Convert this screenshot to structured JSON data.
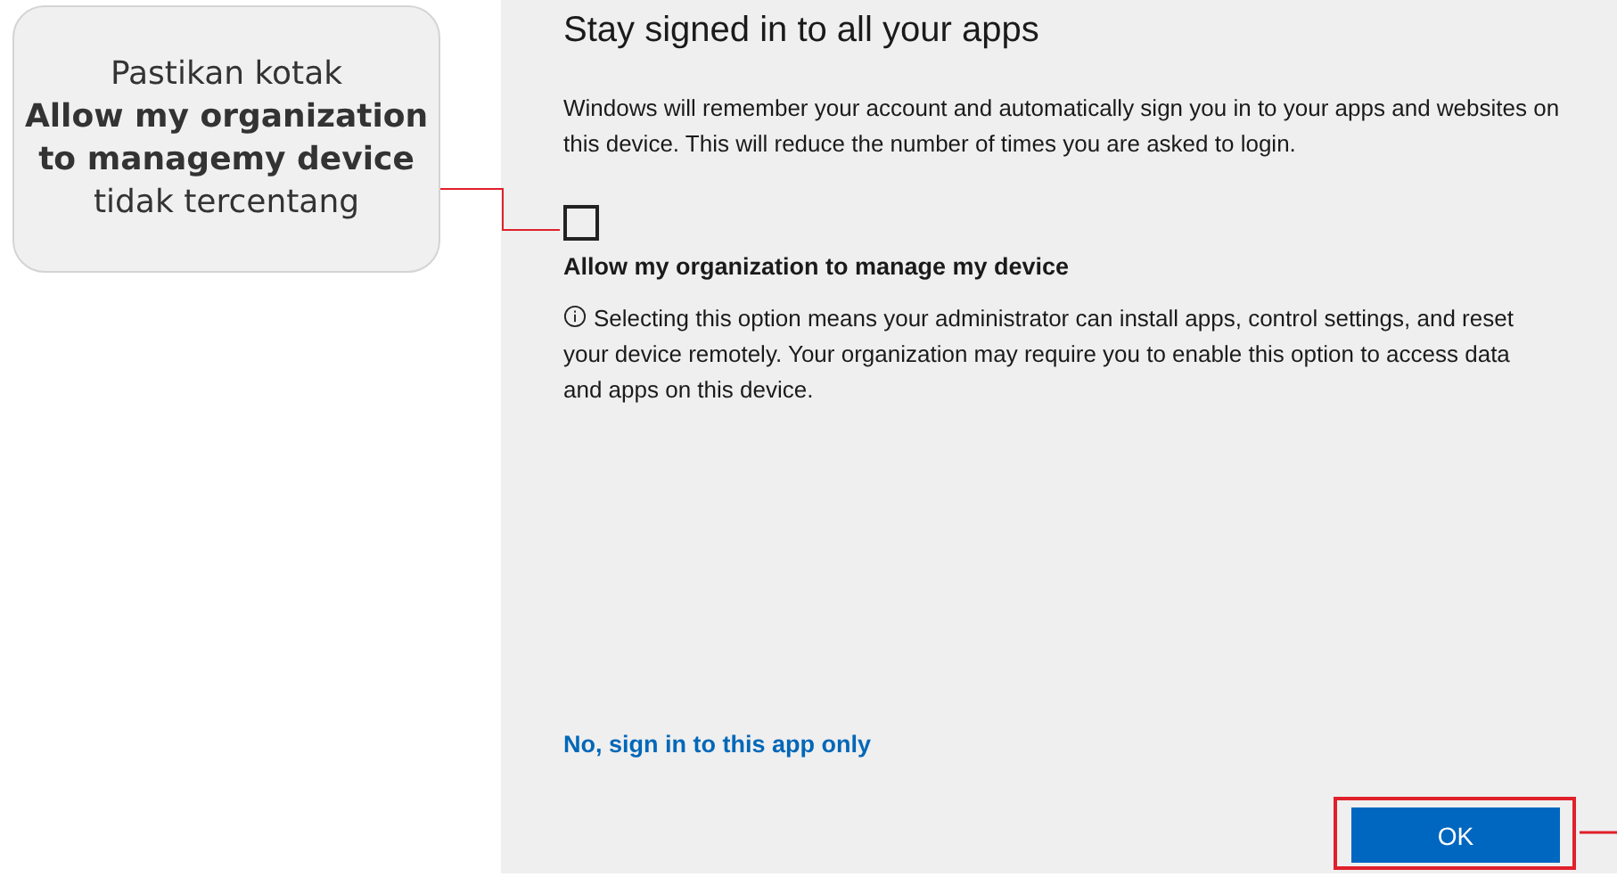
{
  "callout": {
    "text": "Pastikan kotak **Allow my organization to managemy device** tidak tercentang"
  },
  "dialog": {
    "title": "Stay signed in to all your apps",
    "description": "Windows will remember your account and automatically sign you in to your apps and websites on this device. This will reduce the number of times you are asked to login.",
    "checkbox": {
      "label": "Allow my organization to manage my device",
      "checked": false
    },
    "info": "Selecting this option means your administrator can install apps, control settings, and reset your device remotely. Your organization may require you to enable this option to access data and apps on this device.",
    "link": "No, sign in to this app only",
    "button": "OK"
  }
}
